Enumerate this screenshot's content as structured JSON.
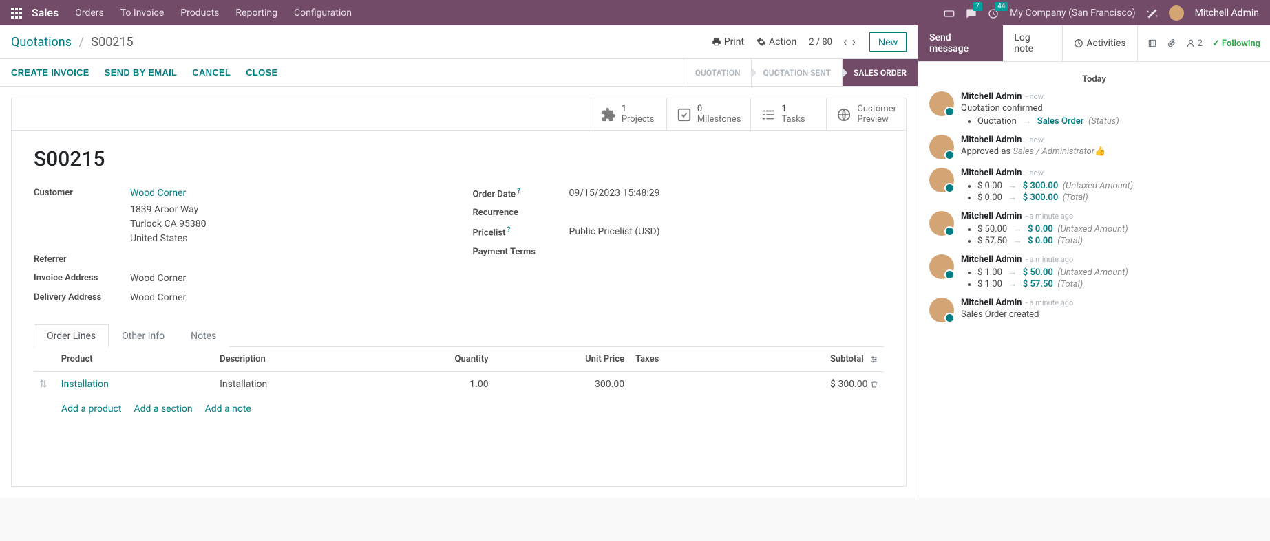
{
  "topbar": {
    "app": "Sales",
    "menus": [
      "Orders",
      "To Invoice",
      "Products",
      "Reporting",
      "Configuration"
    ],
    "chat_badge": "7",
    "clock_badge": "44",
    "company": "My Company (San Francisco)",
    "user": "Mitchell Admin"
  },
  "control_panel": {
    "breadcrumb_root": "Quotations",
    "breadcrumb_current": "S00215",
    "print": "Print",
    "action": "Action",
    "pager": "2 / 80",
    "new": "New"
  },
  "statusbar": {
    "actions": [
      "CREATE INVOICE",
      "SEND BY EMAIL",
      "CANCEL",
      "CLOSE"
    ],
    "steps": [
      "QUOTATION",
      "QUOTATION SENT",
      "SALES ORDER"
    ]
  },
  "stat_buttons": [
    {
      "num": "1",
      "label": "Projects"
    },
    {
      "num": "0",
      "label": "Milestones"
    },
    {
      "num": "1",
      "label": "Tasks"
    },
    {
      "num": "",
      "label": "Customer Preview"
    }
  ],
  "record": {
    "title": "S00215",
    "customer_label": "Customer",
    "customer_name": "Wood Corner",
    "addr1": "1839 Arbor Way",
    "addr2": "Turlock CA 95380",
    "addr3": "United States",
    "referrer_label": "Referrer",
    "invoice_addr_label": "Invoice Address",
    "invoice_addr": "Wood Corner",
    "delivery_addr_label": "Delivery Address",
    "delivery_addr": "Wood Corner",
    "order_date_label": "Order Date",
    "order_date": "09/15/2023 15:48:29",
    "recurrence_label": "Recurrence",
    "pricelist_label": "Pricelist",
    "pricelist": "Public Pricelist (USD)",
    "payment_terms_label": "Payment Terms"
  },
  "tabs": [
    "Order Lines",
    "Other Info",
    "Notes"
  ],
  "order_table": {
    "headers": {
      "product": "Product",
      "desc": "Description",
      "qty": "Quantity",
      "price": "Unit Price",
      "taxes": "Taxes",
      "subtotal": "Subtotal"
    },
    "row": {
      "product": "Installation",
      "desc": "Installation",
      "qty": "1.00",
      "price": "300.00",
      "subtotal": "$ 300.00"
    },
    "add_product": "Add a product",
    "add_section": "Add a section",
    "add_note": "Add a note"
  },
  "chatter": {
    "send": "Send message",
    "log": "Log note",
    "activities": "Activities",
    "followers": "2",
    "following": "Following",
    "date": "Today",
    "messages": [
      {
        "author": "Mitchell Admin",
        "time": "now",
        "text": "Quotation confirmed",
        "changes": [
          {
            "from": "Quotation",
            "to": "Sales Order",
            "field": "(Status)"
          }
        ]
      },
      {
        "author": "Mitchell Admin",
        "time": "now",
        "text_html": "Approved as <i>Sales / Administrator</i> 👍"
      },
      {
        "author": "Mitchell Admin",
        "time": "now",
        "changes": [
          {
            "from": "$ 0.00",
            "to": "$ 300.00",
            "field": "(Untaxed Amount)"
          },
          {
            "from": "$ 0.00",
            "to": "$ 300.00",
            "field": "(Total)"
          }
        ]
      },
      {
        "author": "Mitchell Admin",
        "time": "a minute ago",
        "changes": [
          {
            "from": "$ 50.00",
            "to": "$ 0.00",
            "field": "(Untaxed Amount)"
          },
          {
            "from": "$ 57.50",
            "to": "$ 0.00",
            "field": "(Total)"
          }
        ]
      },
      {
        "author": "Mitchell Admin",
        "time": "a minute ago",
        "changes": [
          {
            "from": "$ 1.00",
            "to": "$ 50.00",
            "field": "(Untaxed Amount)"
          },
          {
            "from": "$ 1.00",
            "to": "$ 57.50",
            "field": "(Total)"
          }
        ]
      },
      {
        "author": "Mitchell Admin",
        "time": "a minute ago",
        "text": "Sales Order created"
      }
    ]
  }
}
